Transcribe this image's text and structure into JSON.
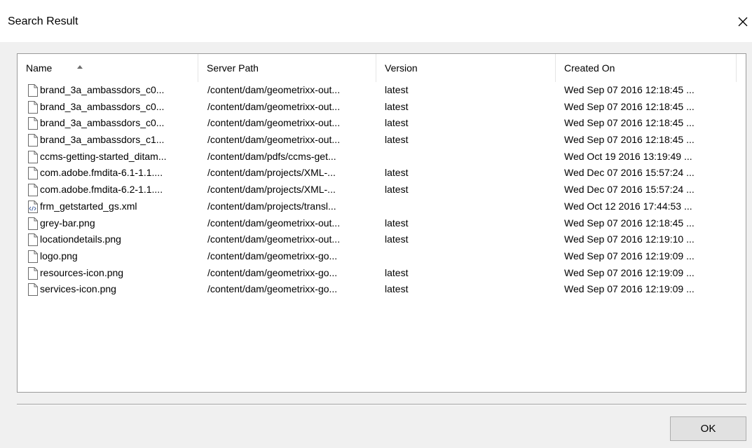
{
  "dialog": {
    "title": "Search Result",
    "ok_label": "OK"
  },
  "columns": [
    {
      "label": "Name",
      "sorted": "ascending"
    },
    {
      "label": "Server Path"
    },
    {
      "label": "Version"
    },
    {
      "label": "Created On"
    }
  ],
  "rows": [
    {
      "icon": "file-icon",
      "name": "brand_3a_ambassdors_c0...",
      "path": "/content/dam/geometrixx-out...",
      "version": "latest",
      "created": "Wed Sep 07 2016 12:18:45 ..."
    },
    {
      "icon": "file-icon",
      "name": "brand_3a_ambassdors_c0...",
      "path": "/content/dam/geometrixx-out...",
      "version": "latest",
      "created": "Wed Sep 07 2016 12:18:45 ..."
    },
    {
      "icon": "file-icon",
      "name": "brand_3a_ambassdors_c0...",
      "path": "/content/dam/geometrixx-out...",
      "version": "latest",
      "created": "Wed Sep 07 2016 12:18:45 ..."
    },
    {
      "icon": "file-icon",
      "name": "brand_3a_ambassdors_c1...",
      "path": "/content/dam/geometrixx-out...",
      "version": "latest",
      "created": "Wed Sep 07 2016 12:18:45 ..."
    },
    {
      "icon": "file-icon",
      "name": "ccms-getting-started_ditam...",
      "path": "/content/dam/pdfs/ccms-get...",
      "version": "",
      "created": "Wed Oct 19 2016 13:19:49 ..."
    },
    {
      "icon": "file-icon",
      "name": "com.adobe.fmdita-6.1-1.1....",
      "path": "/content/dam/projects/XML-...",
      "version": "latest",
      "created": "Wed Dec 07 2016 15:57:24 ..."
    },
    {
      "icon": "file-icon",
      "name": "com.adobe.fmdita-6.2-1.1....",
      "path": "/content/dam/projects/XML-...",
      "version": "latest",
      "created": "Wed Dec 07 2016 15:57:24 ..."
    },
    {
      "icon": "xml-file-icon",
      "name": "frm_getstarted_gs.xml",
      "path": "/content/dam/projects/transl...",
      "version": "",
      "created": "Wed Oct 12 2016 17:44:53 ..."
    },
    {
      "icon": "file-icon",
      "name": "grey-bar.png",
      "path": "/content/dam/geometrixx-out...",
      "version": "latest",
      "created": "Wed Sep 07 2016 12:18:45 ..."
    },
    {
      "icon": "file-icon",
      "name": "locationdetails.png",
      "path": "/content/dam/geometrixx-out...",
      "version": "latest",
      "created": "Wed Sep 07 2016 12:19:10 ..."
    },
    {
      "icon": "file-icon",
      "name": "logo.png",
      "path": "/content/dam/geometrixx-go...",
      "version": "",
      "created": "Wed Sep 07 2016 12:19:09 ..."
    },
    {
      "icon": "file-icon",
      "name": "resources-icon.png",
      "path": "/content/dam/geometrixx-go...",
      "version": "latest",
      "created": "Wed Sep 07 2016 12:19:09 ..."
    },
    {
      "icon": "file-icon",
      "name": "services-icon.png",
      "path": "/content/dam/geometrixx-go...",
      "version": "latest",
      "created": "Wed Sep 07 2016 12:19:09 ..."
    }
  ]
}
